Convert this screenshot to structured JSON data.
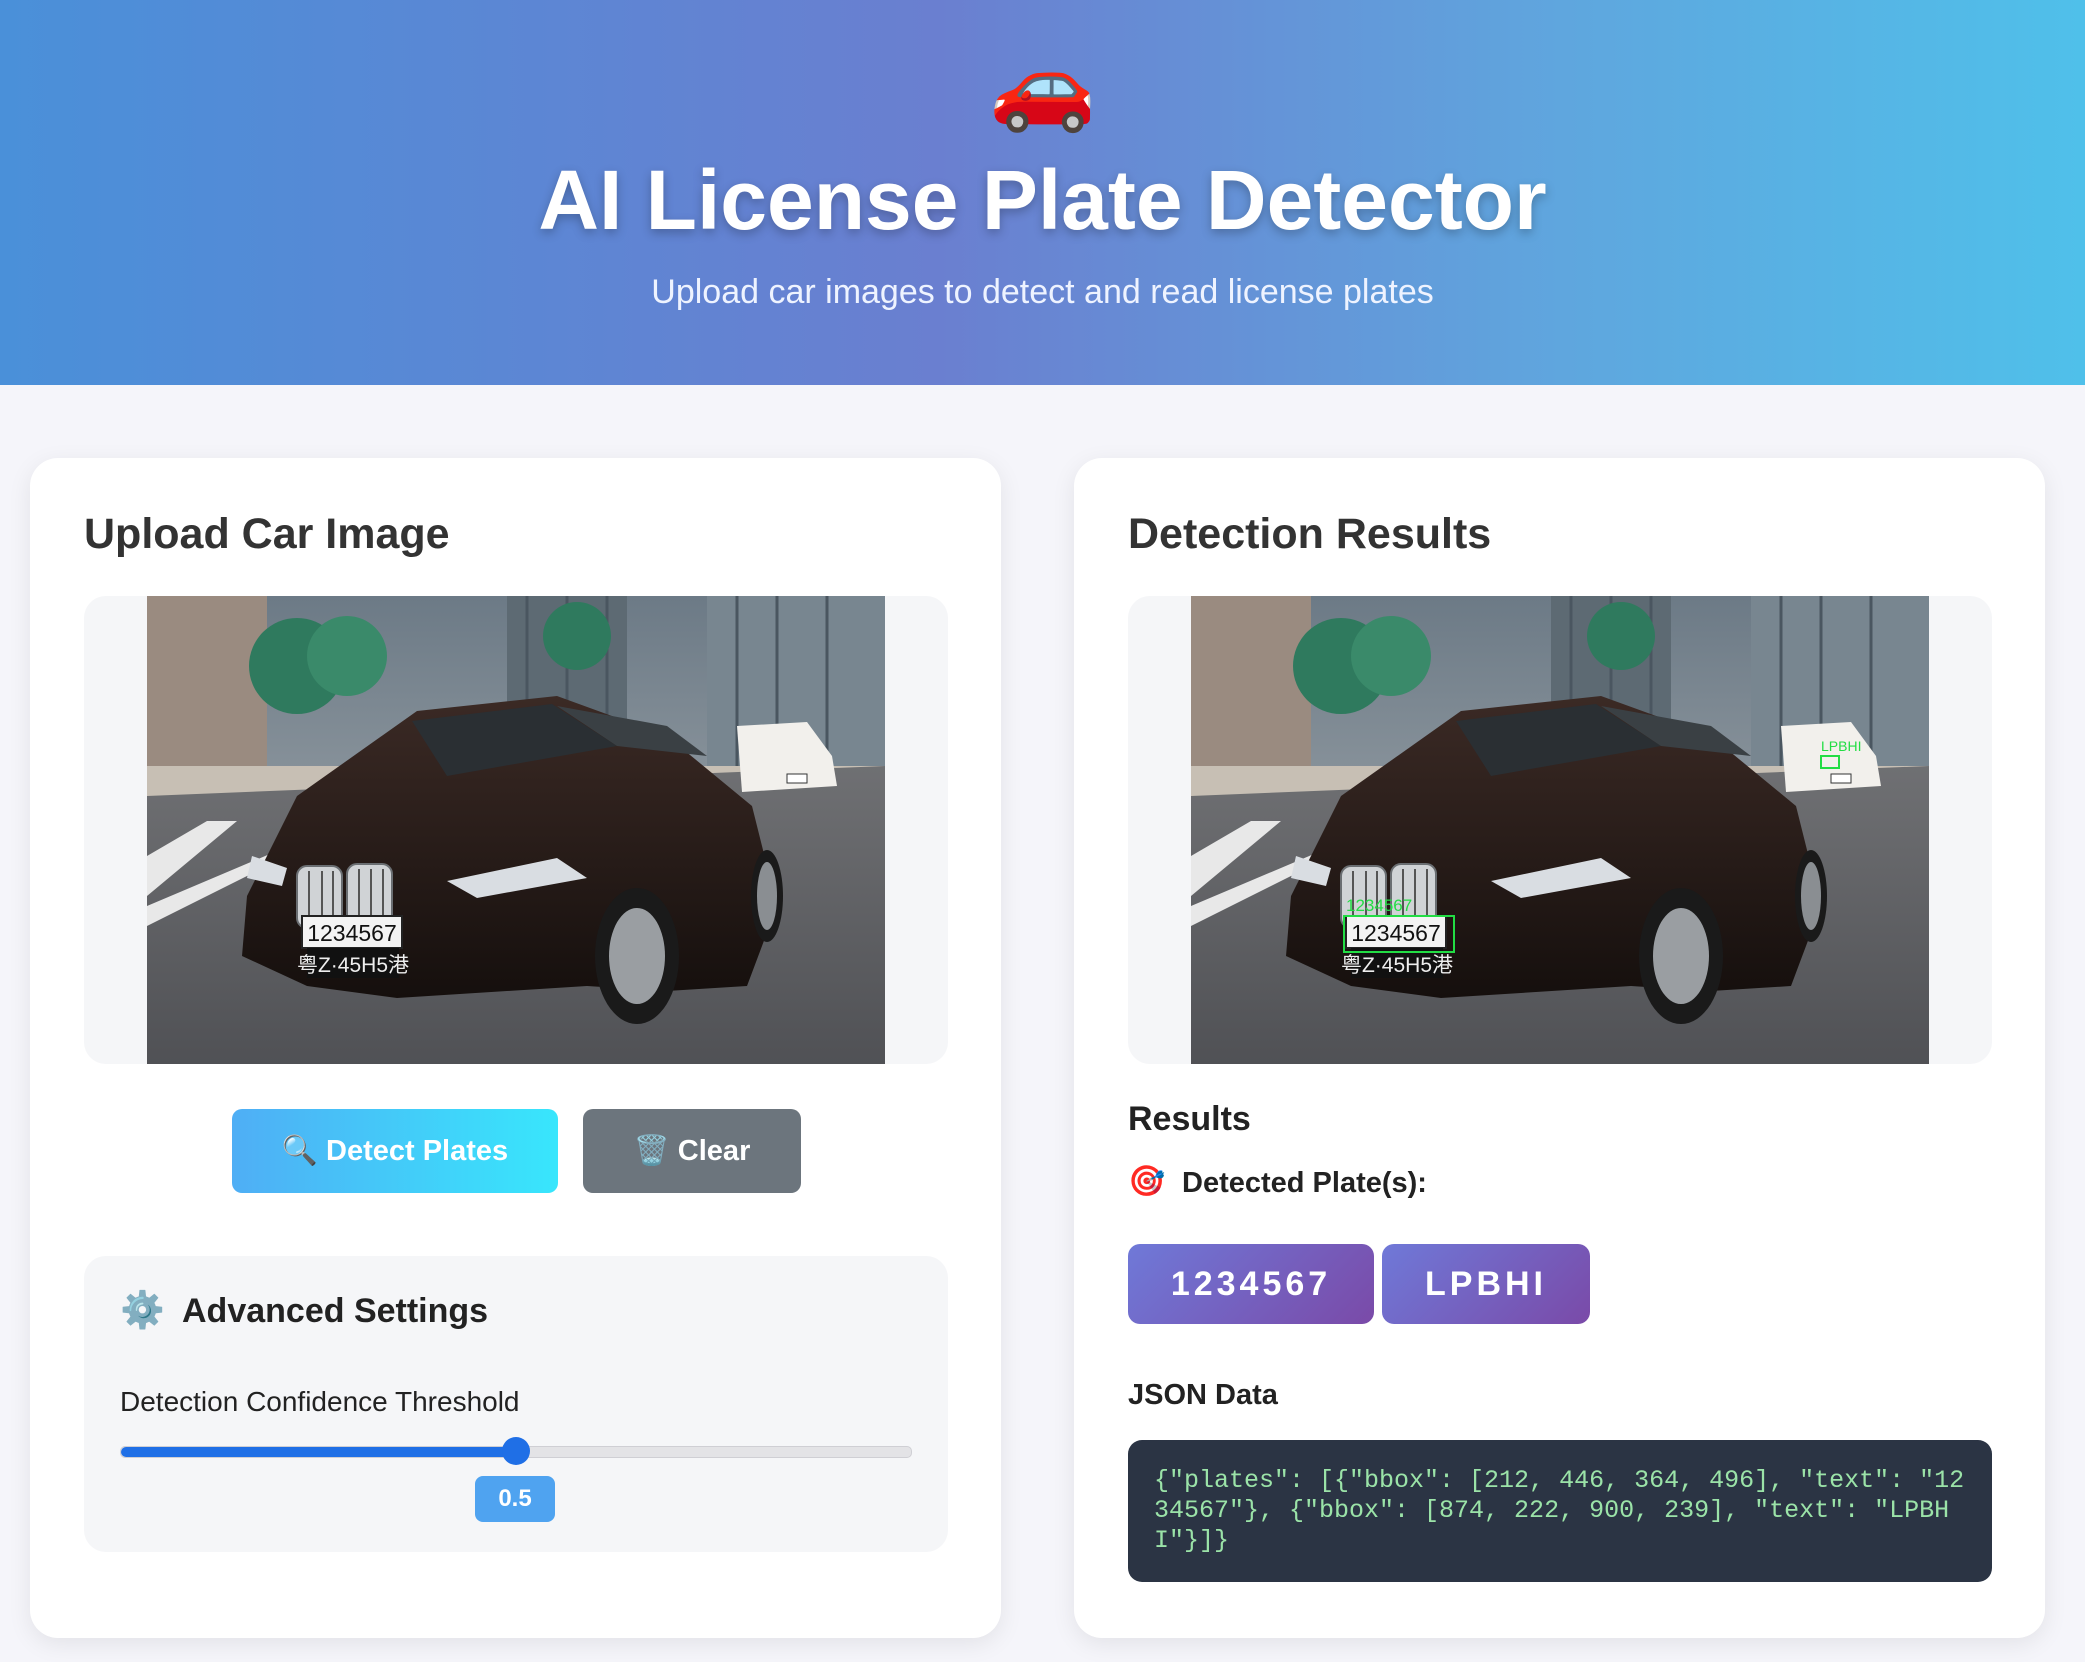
{
  "header": {
    "logo": "🚗",
    "title": "AI License Plate Detector",
    "subtitle": "Upload car images to detect and read license plates"
  },
  "upload": {
    "title": "Upload Car Image",
    "detect_label": "🔍 Detect Plates",
    "clear_label": "🗑️ Clear",
    "settings": {
      "icon": "⚙️",
      "title": "Advanced Settings",
      "slider_label": "Detection Confidence Threshold",
      "value": 0.5,
      "value_label": "0.5",
      "min": 0,
      "max": 1
    }
  },
  "results": {
    "title": "Detection Results",
    "section_title": "Results",
    "detected_icon": "🎯",
    "detected_label": "Detected Plate(s):",
    "plates": [
      "1234567",
      "LPBHI"
    ],
    "json_title": "JSON Data",
    "json_text": "{\"plates\": [{\"bbox\": [212, 446, 364, 496], \"text\": \"1234567\"}, {\"bbox\": [874, 222, 900, 239], \"text\": \"LPBHI\"}]}"
  },
  "photo": {
    "plate_main_line1": "1234567",
    "plate_main_line2": "粤Z·45H5港",
    "plate_far": "LPBHI"
  },
  "colors": {
    "primary": "#1f6fe6",
    "detect_box": "#22dd44",
    "plate_badge": "#6f79d8"
  }
}
